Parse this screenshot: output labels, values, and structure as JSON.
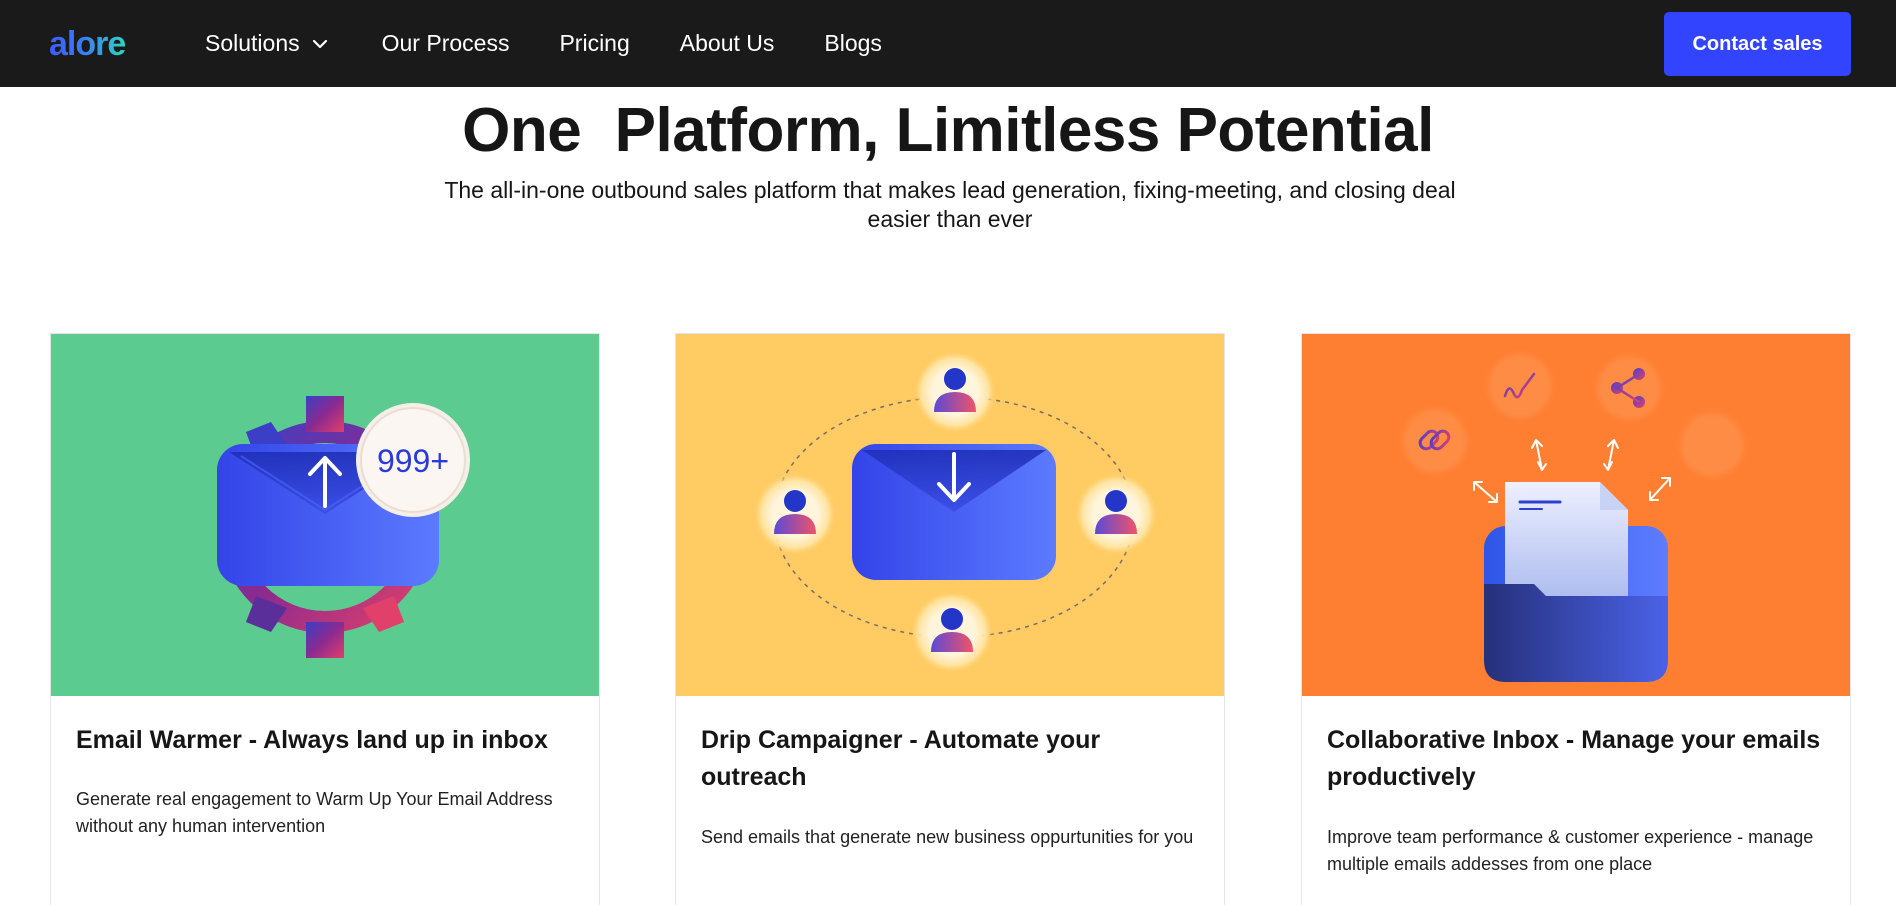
{
  "nav": {
    "logo": "alore",
    "links": [
      "Solutions",
      "Our Process",
      "Pricing",
      "About Us",
      "Blogs"
    ],
    "cta": "Contact sales"
  },
  "hero": {
    "title": "One  Platform, Limitless Potential",
    "subtitle": "The all-in-one outbound sales platform that makes lead generation, fixing-meeting, and closing deal easier than ever"
  },
  "cards": [
    {
      "title": "Email Warmer - Always land up in inbox",
      "description": "Generate real engagement to Warm Up Your Email Address without any human intervention",
      "bg": "#5ccb90",
      "badge": "999+"
    },
    {
      "title": "Drip Campaigner - Automate your outreach",
      "description": "Send emails that generate new business oppurtunities for you",
      "bg": "#ffcb62"
    },
    {
      "title": "Collaborative Inbox - Manage your emails productively",
      "description": "Improve team performance & customer experience - manage multiple emails addesses from one place",
      "bg": "#ff7f32"
    }
  ]
}
